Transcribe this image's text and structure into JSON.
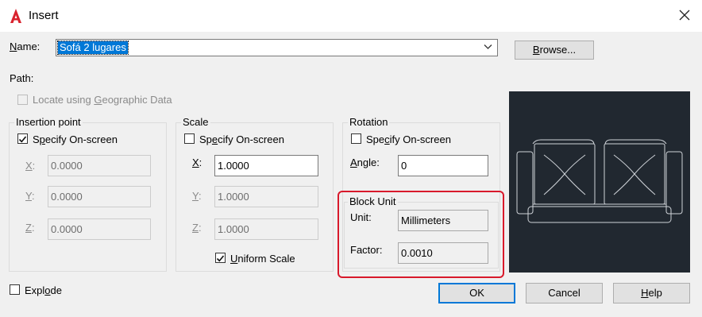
{
  "window": {
    "title": "Insert",
    "icon": "autocad-a-icon"
  },
  "name_field": {
    "label": "Name:",
    "value": "Sofá 2 lugares"
  },
  "browse_label": "Browse...",
  "path_label": "Path:",
  "geo_checkbox": {
    "label": "Locate using Geographic Data",
    "checked": false,
    "enabled": false
  },
  "insertion_point": {
    "title": "Insertion point",
    "specify_label": "Specify On-screen",
    "specify_checked": true,
    "x_label": "X:",
    "x_value": "0.0000",
    "y_label": "Y:",
    "y_value": "0.0000",
    "z_label": "Z:",
    "z_value": "0.0000"
  },
  "scale": {
    "title": "Scale",
    "specify_label": "Specify On-screen",
    "specify_checked": false,
    "x_label": "X:",
    "x_value": "1.0000",
    "y_label": "Y:",
    "y_value": "1.0000",
    "z_label": "Z:",
    "z_value": "1.0000",
    "uniform_label": "Uniform Scale",
    "uniform_checked": true
  },
  "rotation": {
    "title": "Rotation",
    "specify_label": "Specify On-screen",
    "specify_checked": false,
    "angle_label": "Angle:",
    "angle_value": "0"
  },
  "block_unit": {
    "title": "Block Unit",
    "unit_label": "Unit:",
    "unit_value": "Millimeters",
    "factor_label": "Factor:",
    "factor_value": "0.0010",
    "highlight_color": "#d8192b"
  },
  "explode": {
    "label": "Explode",
    "checked": false
  },
  "buttons": {
    "ok": "OK",
    "cancel": "Cancel",
    "help": "Help"
  },
  "colors": {
    "accent": "#0078d7",
    "preview_bg": "#212830"
  }
}
